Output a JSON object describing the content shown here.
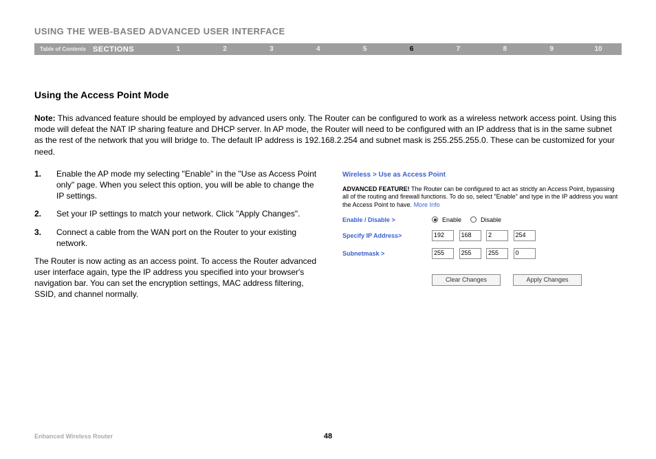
{
  "header": {
    "title": "USING THE WEB-BASED ADVANCED USER INTERFACE"
  },
  "nav": {
    "toc": "Table of Contents",
    "sections_label": "SECTIONS",
    "items": [
      "1",
      "2",
      "3",
      "4",
      "5",
      "6",
      "7",
      "8",
      "9",
      "10"
    ],
    "active": "6"
  },
  "subhead": "Using the Access Point Mode",
  "note": {
    "label": "Note:",
    "text": " This advanced feature should be employed by advanced users only. The Router can be configured to work as a wireless network access point. Using this mode will defeat the NAT IP sharing feature and DHCP server. In AP mode, the Router will need to be configured with an IP address that is in the same subnet as the rest of the network that you will bridge to. The default IP address is 192.168.2.254 and subnet mask is 255.255.255.0. These can be customized for your need."
  },
  "steps": [
    {
      "num": "1.",
      "text": "Enable the AP mode my selecting \"Enable\" in the \"Use as Access Point only\" page. When you select this option, you will be able to change the IP settings."
    },
    {
      "num": "2.",
      "text": "Set your IP settings to match your network. Click \"Apply Changes\"."
    },
    {
      "num": "3.",
      "text": "Connect a cable from the WAN port on the Router to your existing network."
    }
  ],
  "follow": "The Router is now acting as an access point. To access the Router advanced user interface again, type the IP address you specified into your browser's navigation bar. You can set the encryption settings, MAC address filtering, SSID, and channel normally.",
  "router": {
    "breadcrumb": "Wireless > Use as Access Point",
    "adv_label": "ADVANCED FEATURE!",
    "desc": " The Router can be configured to act as strictly an Access Point, bypassing all of the routing and firewall functions. To do so, select \"Enable\" and type in the IP address you want the Access Point to have. ",
    "more_info": "More Info",
    "rows": {
      "enable": {
        "label": "Enable / Disable >",
        "opt1": "Enable",
        "opt2": "Disable"
      },
      "ip": {
        "label": "Specify IP Address>",
        "o1": "192",
        "o2": "168",
        "o3": "2",
        "o4": "254"
      },
      "mask": {
        "label": "Subnetmask >",
        "o1": "255",
        "o2": "255",
        "o3": "255",
        "o4": "0"
      }
    },
    "buttons": {
      "clear": "Clear Changes",
      "apply": "Apply Changes"
    }
  },
  "footer": {
    "model": "Enhanced Wireless Router",
    "page": "48"
  }
}
